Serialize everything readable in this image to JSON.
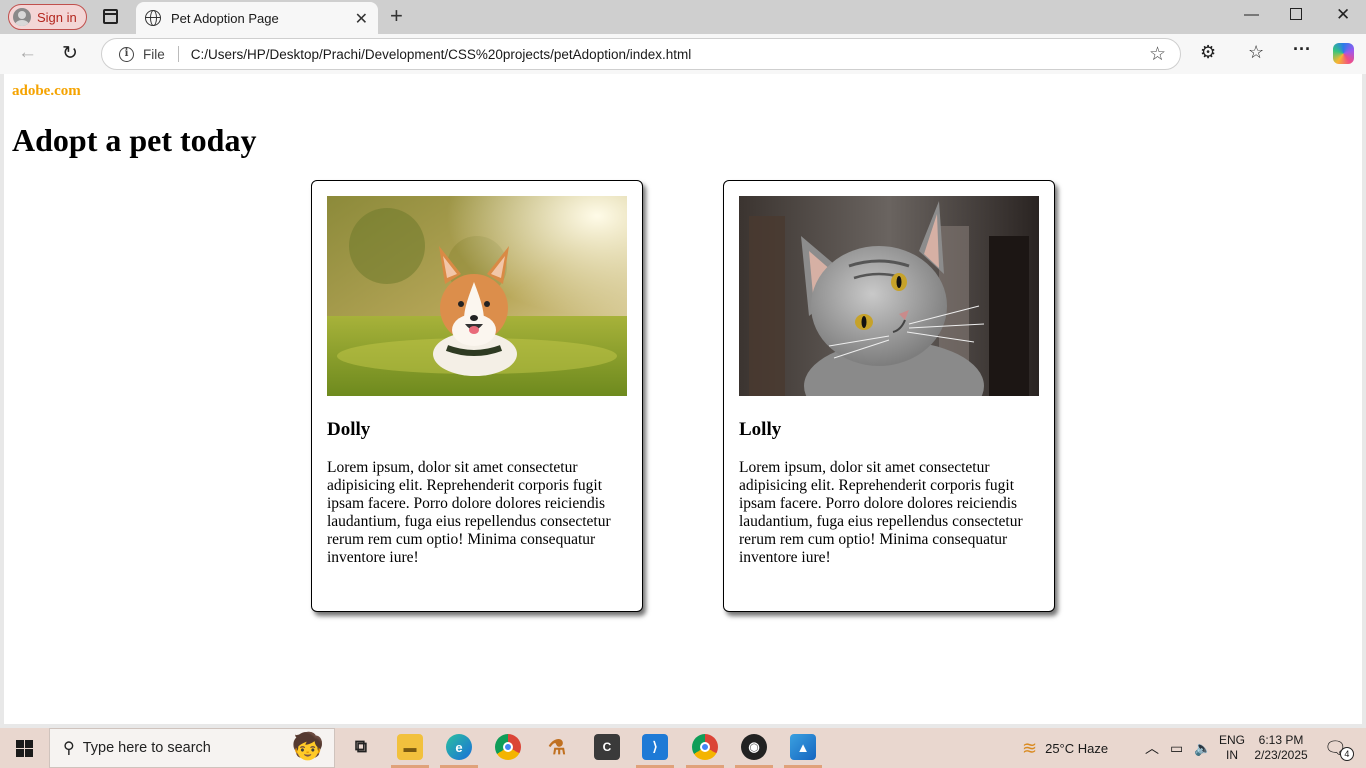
{
  "browser": {
    "signin_label": "Sign in",
    "tab_title": "Pet Adoption Page",
    "url_scheme_label": "File",
    "url": "C:/Users/HP/Desktop/Prachi/Development/CSS%20projects/petAdoption/index.html"
  },
  "page": {
    "brand": "adobe.com",
    "headline": "Adopt a pet today",
    "brand_color": "#f5a300",
    "cards": [
      {
        "name": "Dolly",
        "photo": "corgi-dog-photo",
        "description": "Lorem ipsum, dolor sit amet consectetur adipisicing elit. Reprehenderit corporis fugit ipsam facere. Porro dolore dolores reiciendis laudantium, fuga eius repellendus consectetur rerum rem cum optio! Minima consequatur inventore iure!"
      },
      {
        "name": "Lolly",
        "photo": "grey-tabby-cat-photo",
        "description": "Lorem ipsum, dolor sit amet consectetur adipisicing elit. Reprehenderit corporis fugit ipsam facere. Porro dolore dolores reiciendis laudantium, fuga eius repellendus consectetur rerum rem cum optio! Minima consequatur inventore iure!"
      }
    ]
  },
  "taskbar": {
    "search_placeholder": "Type here to search",
    "weather": "25°C  Haze",
    "lang_top": "ENG",
    "lang_bottom": "IN",
    "time": "6:13 PM",
    "date": "2/23/2025",
    "notification_count": "4"
  }
}
